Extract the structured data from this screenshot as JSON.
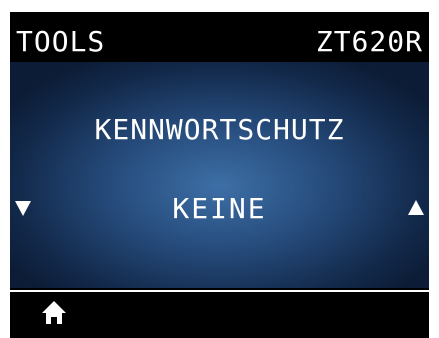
{
  "header": {
    "menu_title": "TOOLS",
    "printer_model": "ZT620R"
  },
  "setting": {
    "label": "KENNWORTSCHUTZ",
    "current_value": "KEINE"
  },
  "icons": {
    "previous": "triangle-down-icon",
    "next": "triangle-up-icon",
    "home": "home-icon"
  },
  "colors": {
    "background": "#000000",
    "panel_center": "#3d6fa6",
    "panel_edge": "#0c1c36",
    "text": "#ffffff"
  }
}
